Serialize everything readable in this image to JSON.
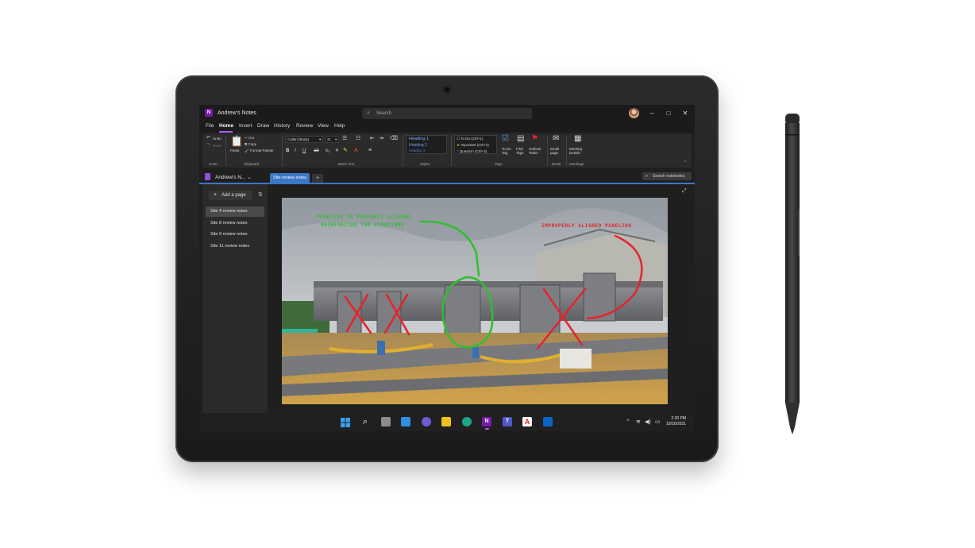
{
  "app": {
    "title": "Andrew's Notes",
    "logo_letter": "N",
    "search_placeholder": "Search",
    "minimize": "–",
    "maximize": "□",
    "close": "✕"
  },
  "menu": {
    "items": [
      "File",
      "Home",
      "Insert",
      "Draw",
      "History",
      "Review",
      "View",
      "Help"
    ],
    "active": "Home"
  },
  "ribbon": {
    "undo": "Undo",
    "redo": "Redo",
    "undo_group": "Undo",
    "paste": "Paste",
    "cut": "Cut",
    "copy": "Copy",
    "format_painter": "Format Painter",
    "clipboard_group": "Clipboard",
    "font_name": "Calibri (Body)",
    "font_size": "21",
    "basic_text_group": "Basic Text",
    "heading1": "Heading 1",
    "heading2": "Heading 2",
    "heading3": "Heading 3",
    "styles_group": "Styles",
    "tag_todo": "To Do (Ctrl+1)",
    "tag_important": "Important (Ctrl+2)",
    "tag_question": "Question (Ctrl+3)",
    "todo_tag": "To Do Tag",
    "find_tags": "Find Tags",
    "outlook_tasks": "Outlook Tasks",
    "tags_group": "Tags",
    "email_page": "Email page",
    "email_group": "Email",
    "meeting_details": "Meeting Details",
    "meetings_group": "Meetings"
  },
  "notebook": {
    "name": "Andrew's N...",
    "section_tab": "Site review notes",
    "add_tab": "+",
    "search_notebooks": "Search notebooks"
  },
  "pages": {
    "add_page": "Add a page",
    "items": [
      "Site 4 review notes",
      "Site 8 review notes",
      "Site 9 review notes",
      "Site 11 review notes"
    ],
    "active_index": 0
  },
  "annotations": {
    "green_line1": "Paneling is properly aligned,",
    "green_line2": "reinforcing the structure",
    "red": "Improperly aligned paneling",
    "green_color": "#2fbf2f",
    "red_color": "#e5232b"
  },
  "taskbar": {
    "time": "2:30 PM",
    "date": "10/20/2021"
  },
  "colors": {
    "accent": "#3a77c6",
    "onenote_purple": "#7719aa"
  }
}
